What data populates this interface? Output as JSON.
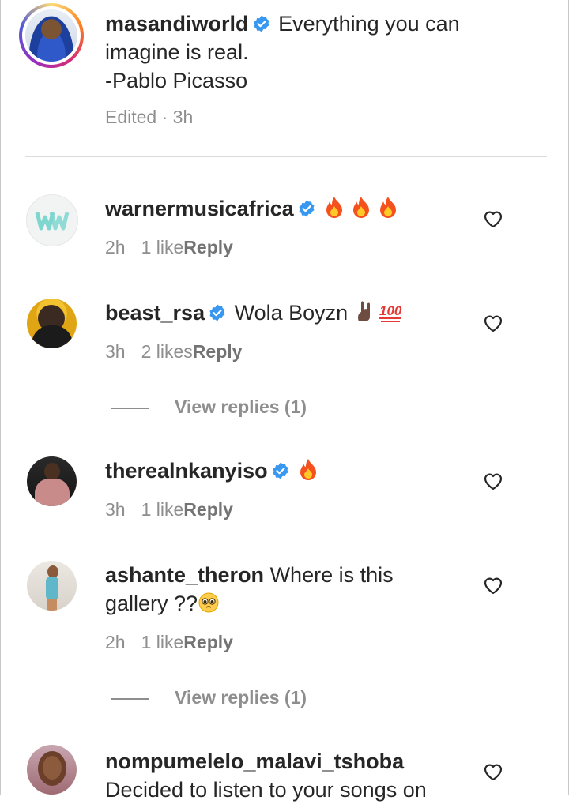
{
  "post": {
    "username": "masandiworld",
    "caption_line1": "Everything you can",
    "caption_line2": "imagine is real.",
    "caption_line3": "-Pablo Picasso",
    "meta": "Edited · 3h"
  },
  "comments": [
    {
      "username": "warnermusicafrica",
      "verified": true,
      "text": "",
      "emoji": [
        "fire",
        "fire",
        "fire"
      ],
      "time": "2h",
      "likes": "1 like",
      "reply": "Reply"
    },
    {
      "username": "beast_rsa",
      "verified": true,
      "text": "Wola Boyzn",
      "emoji": [
        "sign-of-horns",
        "hundred-points"
      ],
      "time": "3h",
      "likes": "2 likes",
      "reply": "Reply",
      "view_replies": "View replies (1)"
    },
    {
      "username": "therealnkanyiso",
      "verified": true,
      "text": "",
      "emoji": [
        "fire"
      ],
      "time": "3h",
      "likes": "1 like",
      "reply": "Reply"
    },
    {
      "username": "ashante_theron",
      "verified": false,
      "text_line1": "Where is this",
      "text_line2": "gallery ??",
      "emoji": [
        "pleading-face"
      ],
      "time": "2h",
      "likes": "1 like",
      "reply": "Reply",
      "view_replies": "View replies (1)"
    },
    {
      "username": "nompumelelo_malavi_tshoba",
      "verified": false,
      "text_line1": "Decided to listen to your songs on"
    }
  ],
  "colors": {
    "verified_badge": "#3897f0",
    "text_primary": "#262626",
    "text_secondary": "#8e8e8e"
  }
}
